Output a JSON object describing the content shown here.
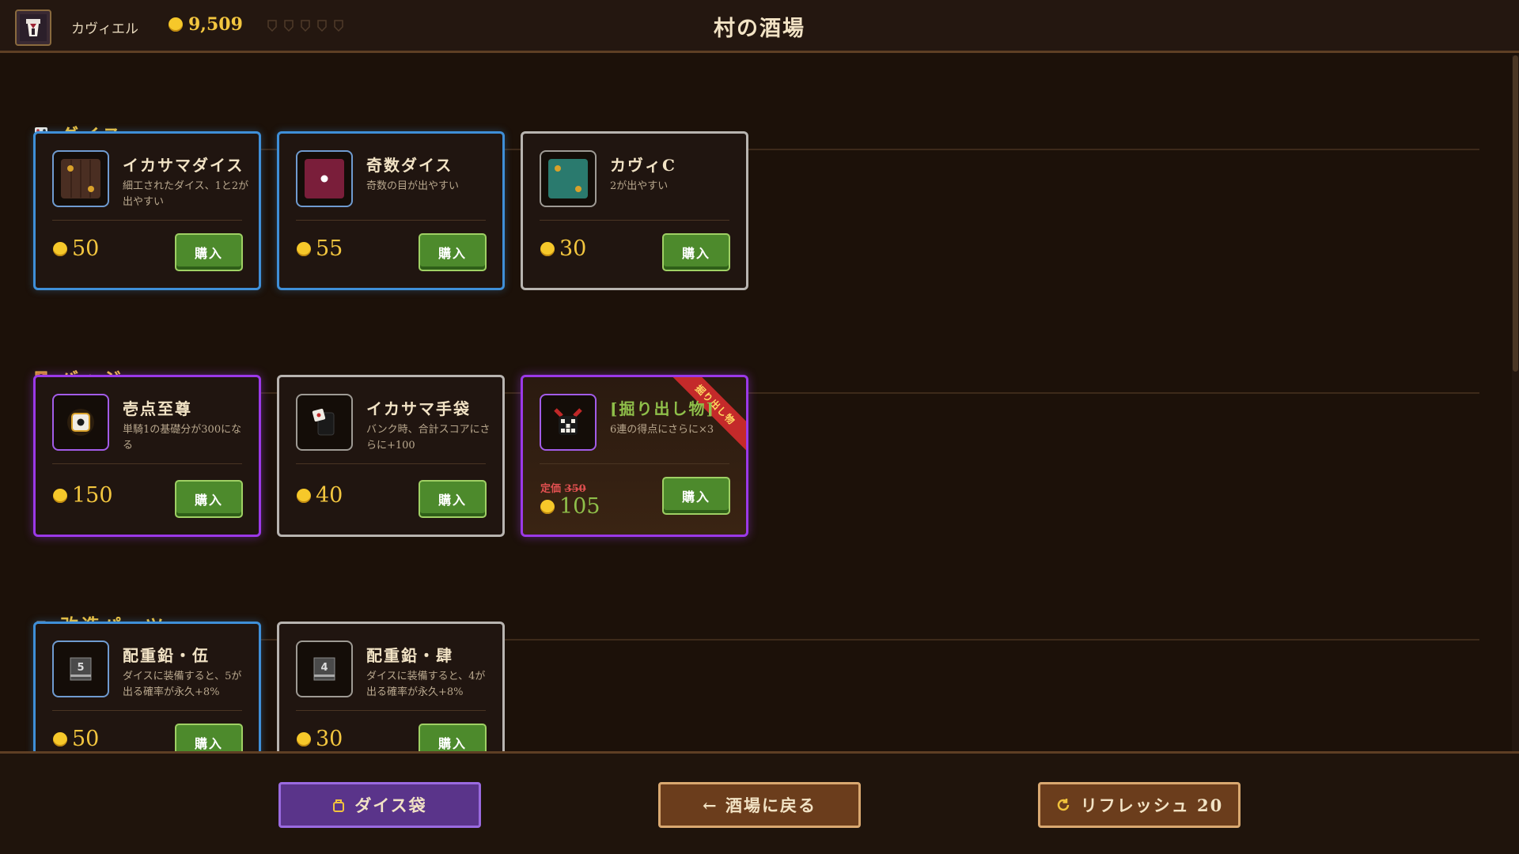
{
  "header": {
    "player_name": "カヴィエル",
    "gold": "9,509",
    "title": "村の酒場"
  },
  "sections": [
    {
      "title": "ダイス",
      "icon": "dice-icon",
      "items": [
        {
          "name": "イカサマダイス",
          "desc": "細工されたダイス、1と2が出やすい",
          "price": "50",
          "buy_label": "購入",
          "rarity": "blue"
        },
        {
          "name": "奇数ダイス",
          "desc": "奇数の目が出やすい",
          "price": "55",
          "buy_label": "購入",
          "rarity": "blue"
        },
        {
          "name": "カヴィC",
          "desc": "2が出やすい",
          "price": "30",
          "buy_label": "購入",
          "rarity": "gray"
        }
      ]
    },
    {
      "title": "バッジ",
      "icon": "badge-icon",
      "items": [
        {
          "name": "壱点至尊",
          "desc": "単騎1の基礎分が300になる",
          "price": "150",
          "buy_label": "購入",
          "rarity": "purple"
        },
        {
          "name": "イカサマ手袋",
          "desc": "バンク時、合計スコアにさらに+100",
          "price": "40",
          "buy_label": "購入",
          "rarity": "gray"
        },
        {
          "name": "[掘り出し物]",
          "desc": "6連の得点にさらに×3",
          "orig_label": "定価",
          "orig_price": "350",
          "price": "105",
          "buy_label": "購入",
          "rarity": "purple",
          "ribbon": "掘り出し物"
        }
      ]
    },
    {
      "title": "改造パーツ",
      "icon": "parts-icon",
      "items": [
        {
          "name": "配重鉛・伍",
          "desc": "ダイスに装備すると、5が出る確率が永久+8%",
          "price": "50",
          "buy_label": "購入",
          "rarity": "blue",
          "weight_num": "5"
        },
        {
          "name": "配重鉛・肆",
          "desc": "ダイスに装備すると、4が出る確率が永久+8%",
          "price": "30",
          "buy_label": "購入",
          "rarity": "gray",
          "weight_num": "4"
        }
      ]
    }
  ],
  "footer": {
    "bag_label": "ダイス袋",
    "back_label": "← 酒場に戻る",
    "refresh_label": "リフレッシュ 20"
  },
  "colors": {
    "gold": "#f3c63f",
    "blue_rarity": "#3f8fd8",
    "purple_rarity": "#9b39e8",
    "gray_rarity": "#b8b4b0",
    "buy_green": "#4d8a2c"
  }
}
